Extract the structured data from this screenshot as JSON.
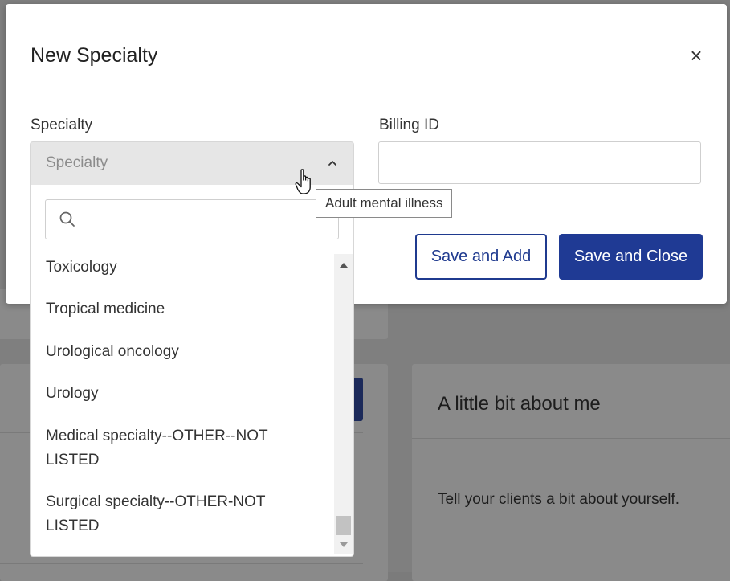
{
  "background": {
    "right_card_title": "A little bit about me",
    "right_card_text": "Tell your clients a bit about yourself."
  },
  "modal": {
    "title": "New Specialty",
    "close_icon": "close-icon",
    "specialty_label": "Specialty",
    "specialty_placeholder": "Specialty",
    "billing_label": "Billing ID",
    "billing_value": "",
    "save_add_label": "Save and Add",
    "save_close_label": "Save and Close"
  },
  "dropdown": {
    "search_value": "",
    "options": [
      "Toxicology",
      "Tropical medicine",
      "Urological oncology",
      "Urology",
      "Medical specialty--OTHER--NOT LISTED",
      "Surgical specialty--OTHER-NOT LISTED"
    ],
    "scroll_position": 0.95
  },
  "tooltip": {
    "text": "Adult mental illness"
  },
  "colors": {
    "primary": "#1f3a94",
    "overlay": "#7f7f7f"
  }
}
